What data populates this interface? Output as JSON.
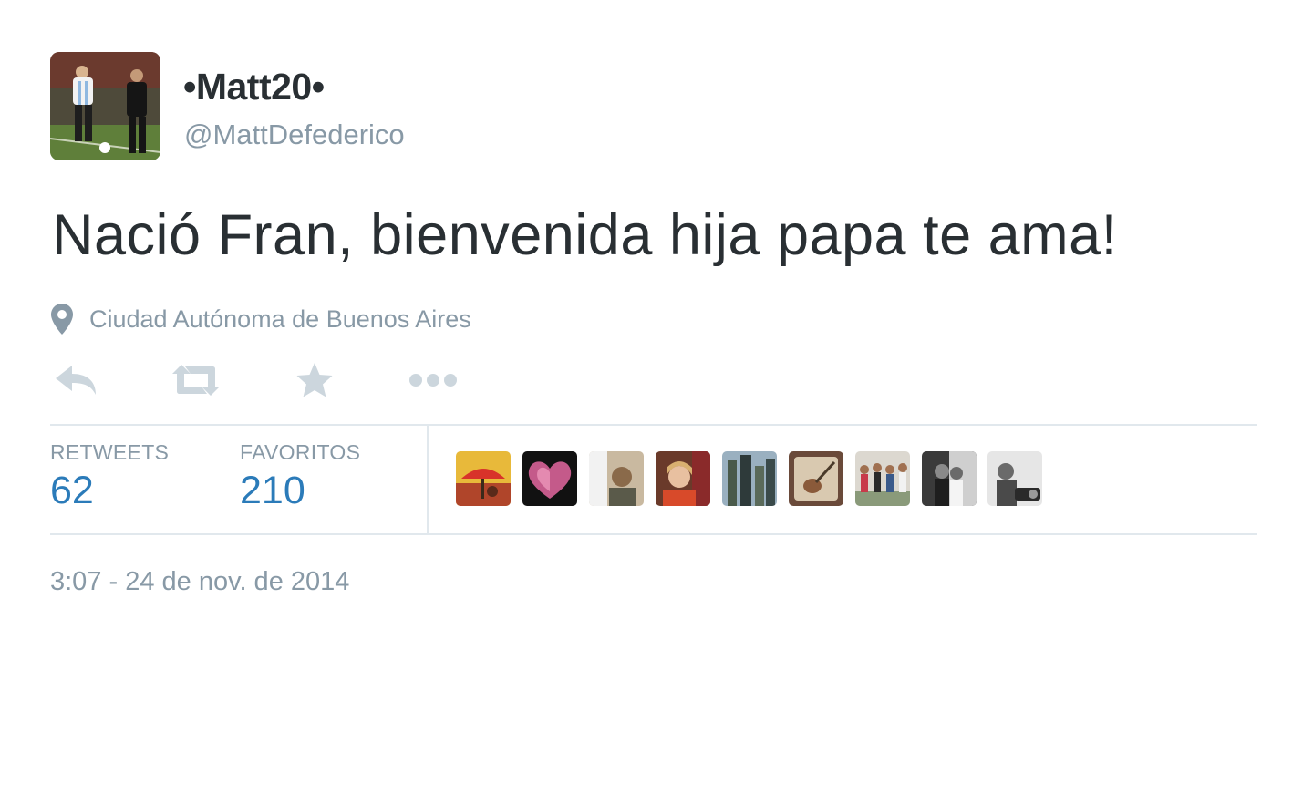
{
  "tweet": {
    "display_name": "•Matt20•",
    "handle": "@MattDefederico",
    "text": "Nació Fran, bienvenida hija papa te ama!",
    "location": "Ciudad Autónoma de Buenos Aires",
    "timestamp": "3:07 - 24 de nov. de 2014",
    "avatar_icon": "footballer-photo-avatar"
  },
  "actions": [
    {
      "name": "reply",
      "icon": "reply-icon"
    },
    {
      "name": "retweet",
      "icon": "retweet-icon"
    },
    {
      "name": "favorite",
      "icon": "star-icon"
    },
    {
      "name": "more",
      "icon": "more-dots-icon"
    }
  ],
  "stats": {
    "retweets_label": "RETWEETS",
    "retweets_count": "62",
    "favorites_label": "FAVORITOS",
    "favorites_count": "210"
  },
  "favoriters": [
    {
      "icon": "umbrella-photo-avatar"
    },
    {
      "icon": "heart-photo-avatar"
    },
    {
      "icon": "person-photo-avatar"
    },
    {
      "icon": "woman-photo-avatar"
    },
    {
      "icon": "city-photo-avatar"
    },
    {
      "icon": "guitar-photo-avatar"
    },
    {
      "icon": "group-photo-avatar"
    },
    {
      "icon": "couple-photo-avatar"
    },
    {
      "icon": "bw-person-photo-avatar"
    }
  ],
  "colors": {
    "text": "#292f33",
    "muted": "#8899a6",
    "link_blue": "#2b7bb9",
    "divider": "#e1e8ed",
    "action_icon": "#ccd6dd"
  }
}
